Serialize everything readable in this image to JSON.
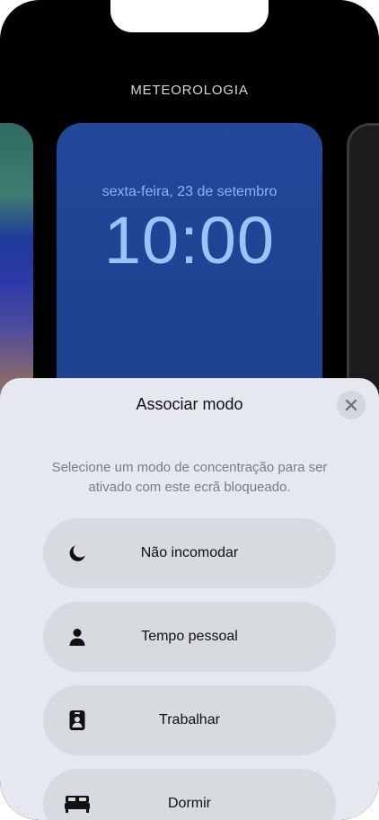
{
  "gallery": {
    "title": "METEOROLOGIA"
  },
  "lockscreen": {
    "date": "sexta-feira, 23 de setembro",
    "time": "10:00"
  },
  "sheet": {
    "title": "Associar modo",
    "close_icon": "close-icon",
    "description": "Selecione um modo de concentração para ser ativado com este ecrã bloqueado.",
    "modes": [
      {
        "label": "Não incomodar",
        "icon": "moon-icon"
      },
      {
        "label": "Tempo pessoal",
        "icon": "person-icon"
      },
      {
        "label": "Trabalhar",
        "icon": "id-badge-icon"
      },
      {
        "label": "Dormir",
        "icon": "bed-icon"
      }
    ]
  }
}
